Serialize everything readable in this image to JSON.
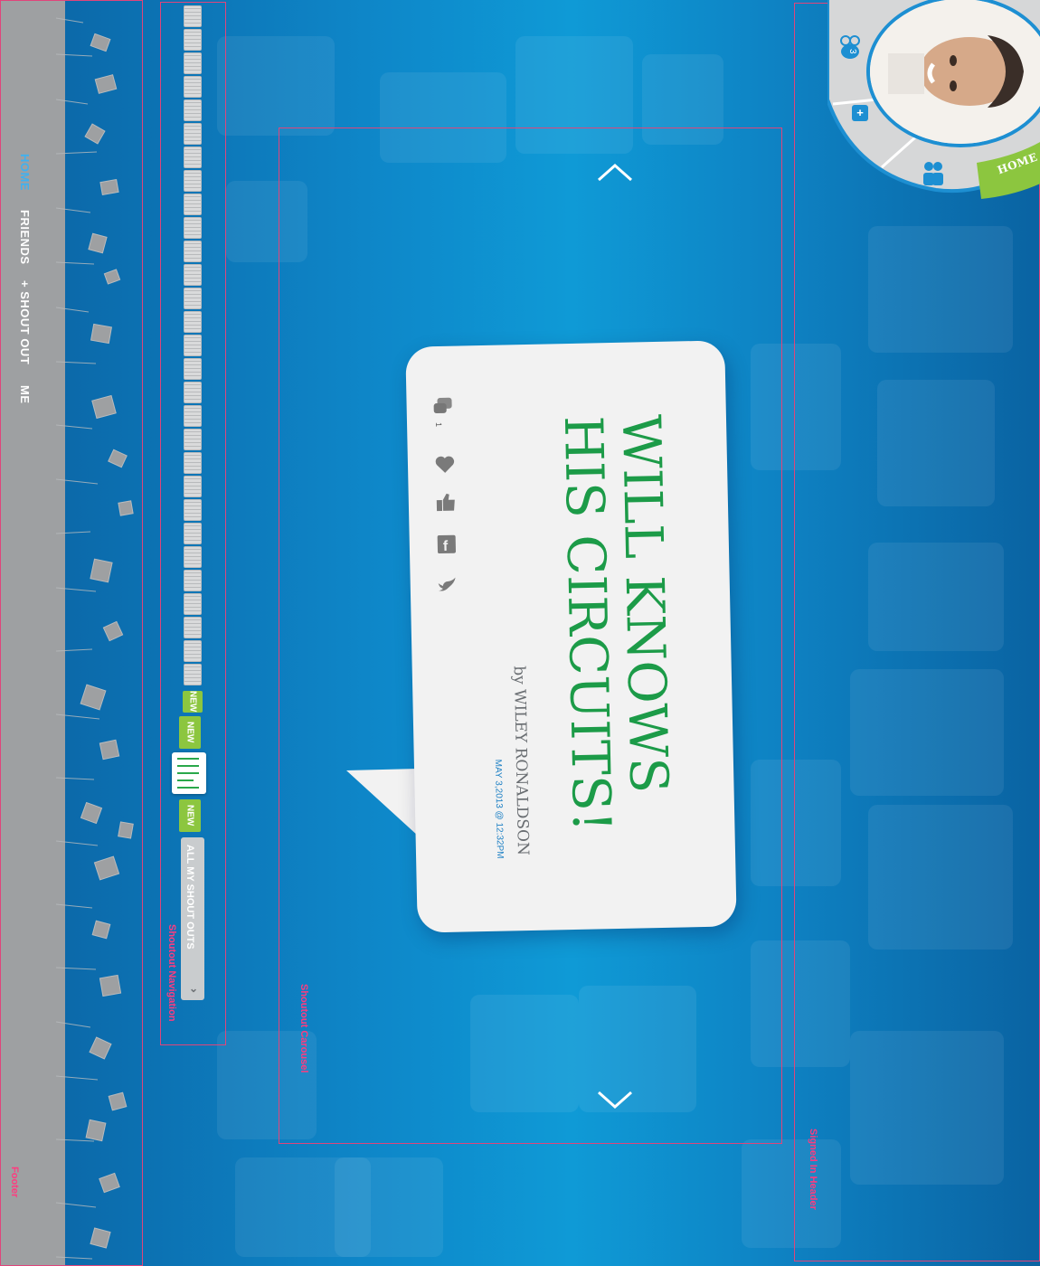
{
  "footer": {
    "nav": [
      {
        "label": "HOME",
        "active": true
      },
      {
        "label": "FRIENDS",
        "active": false
      },
      {
        "label": "+ SHOUT OUT",
        "active": false
      },
      {
        "label": "ME",
        "active": false
      }
    ]
  },
  "annotations": {
    "footer": "Footer",
    "shoutout_navigation": "Shoutout Navigation",
    "shoutout_carousel": "Shoutout Carousel",
    "signed_in_header": "Signed In Header"
  },
  "shoutout_nav": {
    "new_tag": "NEW",
    "all_button": "ALL MY SHOUT OUTS",
    "all_icon": "chevron-down-icon"
  },
  "carousel": {
    "up_icon": "chevron-up-icon",
    "down_icon": "chevron-down-icon",
    "card": {
      "title_line1": "WILL KNOWS",
      "title_line2": "HIS CIRCUITS!",
      "author": "by WILEY RONALDSON",
      "date": "MAY 3,2013 @ 12:32PM",
      "comment_count": "1"
    }
  },
  "header": {
    "friends_badge": "3",
    "add_icon": "+",
    "home_label": "HOME"
  },
  "colors": {
    "accent_blue": "#0f9ad6",
    "title_green": "#1c9b48",
    "lime": "#8cc63f",
    "annotation_pink": "#ff3b7f"
  }
}
